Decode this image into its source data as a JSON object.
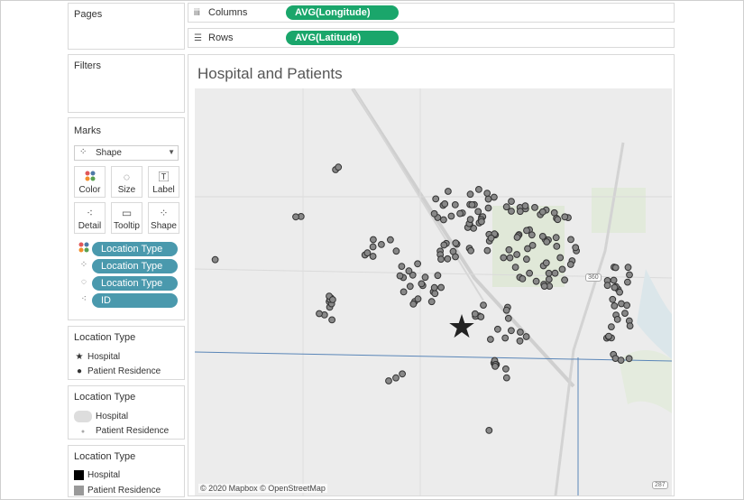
{
  "side": {
    "pages_title": "Pages",
    "filters_title": "Filters",
    "marks_title": "Marks",
    "mark_type": "Shape",
    "buttons": [
      "Color",
      "Size",
      "Label",
      "Detail",
      "Tooltip",
      "Shape"
    ],
    "pills": [
      "Location Type",
      "Location Type",
      "Location Type",
      "ID"
    ]
  },
  "legends": [
    {
      "title": "Location Type",
      "items": [
        "Hospital",
        "Patient Residence"
      ]
    },
    {
      "title": "Location Type",
      "items": [
        "Hospital",
        "Patient Residence"
      ]
    },
    {
      "title": "Location Type",
      "items": [
        "Hospital",
        "Patient Residence"
      ]
    }
  ],
  "shelves": {
    "columns_label": "Columns",
    "columns_pill": "AVG(Longitude)",
    "rows_label": "Rows",
    "rows_pill": "AVG(Latitude)"
  },
  "viz": {
    "title": "Hospital and Patients",
    "attribution": "© 2020 Mapbox © OpenStreetMap",
    "shield_360": "360",
    "shield_287": "287"
  },
  "colors": {
    "pill_green": "#1aa66b",
    "pill_blue": "#4a99ad",
    "marker": "#888888",
    "hospital": "#222222"
  }
}
